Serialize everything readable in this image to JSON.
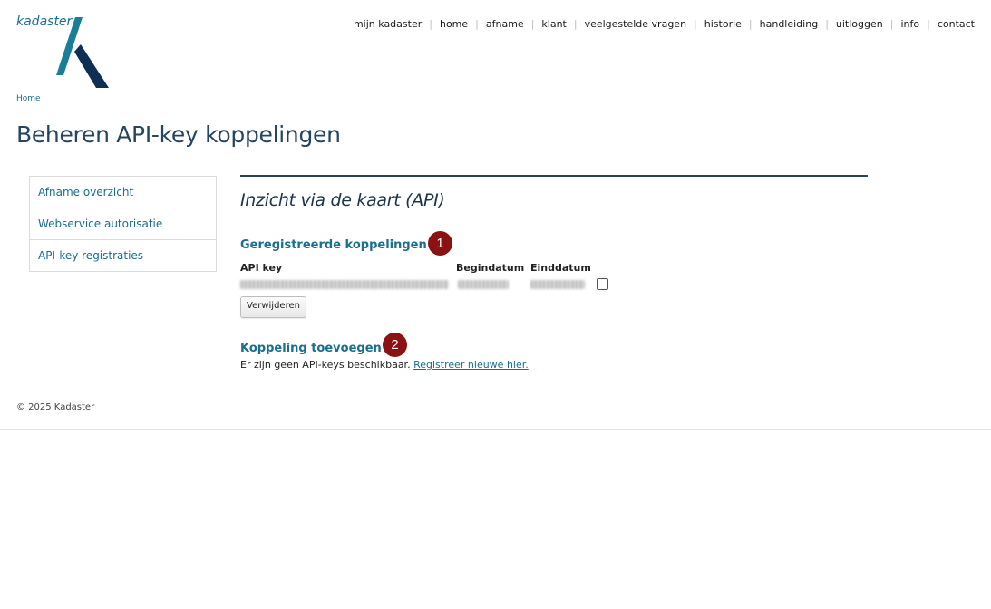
{
  "logo": {
    "text": "kadaster"
  },
  "topnav": [
    "mijn kadaster",
    "home",
    "afname",
    "klant",
    "veelgestelde vragen",
    "historie",
    "handleiding",
    "uitloggen",
    "info",
    "contact"
  ],
  "breadcrumb": "Home",
  "page_title": "Beheren API-key koppelingen",
  "sidebar": {
    "items": [
      {
        "label": "Afname overzicht"
      },
      {
        "label": "Webservice autorisatie"
      },
      {
        "label": "API-key registraties"
      }
    ]
  },
  "main": {
    "section_title": "Inzicht via de kaart (API)",
    "registered": {
      "heading": "Geregistreerde koppelingen",
      "badge": "1",
      "columns": [
        "API key",
        "Begindatum",
        "Einddatum"
      ],
      "delete_label": "Verwijderen"
    },
    "add": {
      "heading": "Koppeling toevoegen",
      "badge": "2",
      "message": "Er zijn geen API-keys beschikbaar.",
      "link": "Registreer nieuwe hier."
    }
  },
  "footer": "© 2025 Kadaster",
  "colors": {
    "accent": "#1a6e8e",
    "title": "#25465f",
    "badge": "#8b1212"
  }
}
